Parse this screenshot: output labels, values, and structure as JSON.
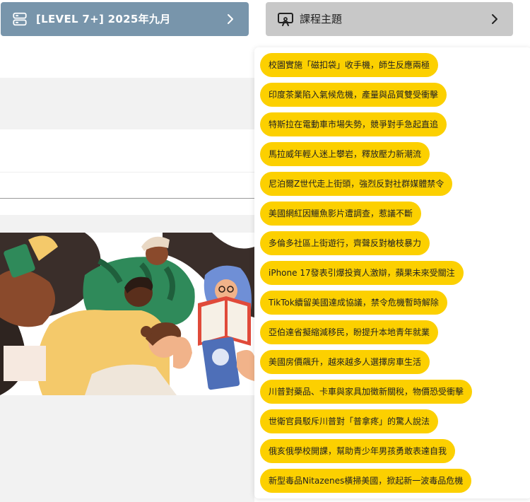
{
  "header": {
    "level_label": "[LEVEL 7+] 2025年九月",
    "level_icon": "server-stack-icon",
    "topic_label": "課程主題",
    "topic_icon": "presentation-board-icon",
    "chevron_icon": "chevron-right-icon"
  },
  "colors": {
    "level_button": "#7895ab",
    "topic_button": "#c8c8c8",
    "topic_chip": "#fcd000"
  },
  "topics": [
    "校園實施「磁扣袋」收手機，師生反應兩極",
    "印度茶業陷入氣候危機，產量與品質雙受衝擊",
    "特斯拉在電動車市場失勢，競爭對手急起直追",
    "馬拉威年輕人迷上攀岩，釋放壓力新潮流",
    "尼泊爾Z世代走上街頭，強烈反對社群媒體禁令",
    "美國網紅因鱷魚影片遭調查，惹議不斷",
    "多倫多社區上街遊行，齊聲反對槍枝暴力",
    "iPhone 17發表引爆投資人激辯，蘋果未來受關注",
    "TikTok續留美國達成協議，禁令危機暫時解除",
    "亞伯達省擬縮減移民，盼提升本地青年就業",
    "美國房價飆升，越來越多人選擇房車生活",
    "川普對藥品、卡車與家具加徵新關稅，物價恐受衝擊",
    "世衛官員駁斥川普對「普拿疼」的驚人說法",
    "俄亥俄學校開課，幫助青少年男孩勇敢表達自我",
    "新型毒品Nitazenes橫掃美國，掀起新一波毒品危機"
  ]
}
